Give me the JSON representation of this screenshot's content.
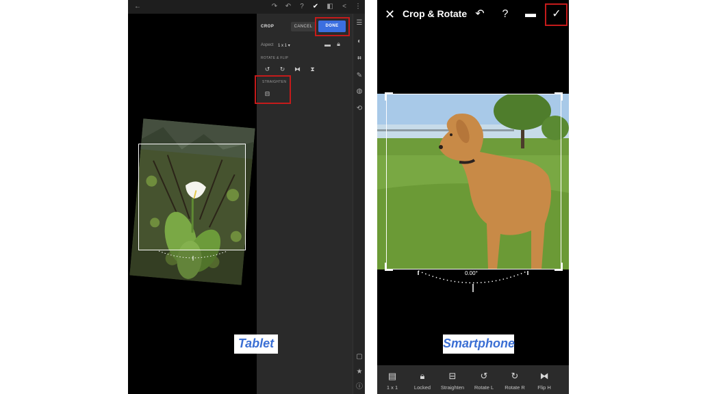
{
  "tablet": {
    "crop_title": "CROP",
    "cancel_label": "CANCEL",
    "done_label": "DONE",
    "aspect_label": "Aspect",
    "aspect_value": "1 x 1",
    "rotate_flip_label": "ROTATE & FLIP",
    "straighten_label": "STRAIGHTEN",
    "caption": "Tablet"
  },
  "phone": {
    "title": "Crop & Rotate",
    "angle_readout": "0.00°",
    "caption": "Smartphone",
    "tools": [
      {
        "label": "1 x 1",
        "icon": "aspect-icon"
      },
      {
        "label": "Locked",
        "icon": "lock-icon"
      },
      {
        "label": "Straighten",
        "icon": "straighten-icon"
      },
      {
        "label": "Rotate L",
        "icon": "rotate-left-icon"
      },
      {
        "label": "Rotate R",
        "icon": "rotate-right-icon"
      },
      {
        "label": "Flip H",
        "icon": "flip-horizontal-icon"
      }
    ]
  },
  "colors": {
    "highlight_red": "#c61b1b",
    "done_blue": "#3b6fe0",
    "caption_blue": "#3b6fd4"
  }
}
